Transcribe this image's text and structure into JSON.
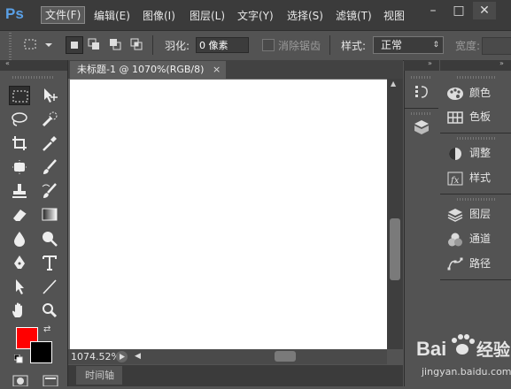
{
  "app": {
    "logo": "Ps"
  },
  "menu": {
    "items": [
      "文件(F)",
      "编辑(E)",
      "图像(I)",
      "图层(L)",
      "文字(Y)",
      "选择(S)",
      "滤镜(T)",
      "视图"
    ],
    "window_controls": [
      "–",
      "□",
      "✕"
    ]
  },
  "options": {
    "feather_label": "羽化:",
    "feather_value": "0 像素",
    "antialias_label": "消除锯齿",
    "style_label": "样式:",
    "style_value": "正常",
    "width_label": "宽度:"
  },
  "document": {
    "tab_title": "未标题-1 @ 1070%(RGB/8)",
    "tab_close": "×",
    "zoom": "1074.52%",
    "timeline_label": "时间轴"
  },
  "colors": {
    "foreground": "#ff0000",
    "background": "#000000"
  },
  "panels": {
    "group1": [
      "颜色",
      "色板"
    ],
    "group2": [
      "调整",
      "样式"
    ],
    "group3": [
      "图层",
      "通道",
      "路径"
    ]
  },
  "watermark": {
    "brand": "Bai",
    "brand2": "经验",
    "url": "jingyan.baidu.com"
  }
}
